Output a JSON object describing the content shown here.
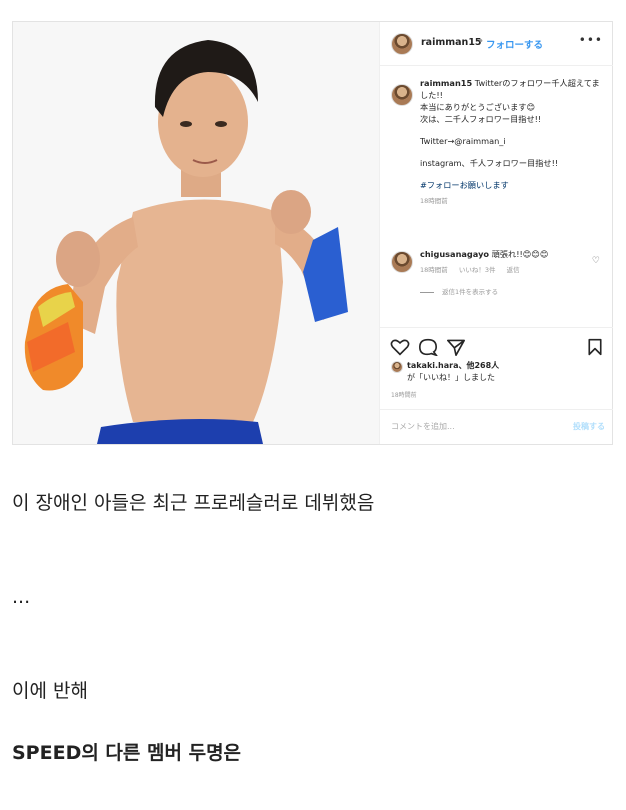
{
  "post": {
    "username": "raimman15",
    "follow_label": "フォローする",
    "caption_lines": [
      "Twitterのフォロワー千人超えてました!!",
      "本当にありがとうございます😊",
      "次は、二千人フォロワー目指せ!!"
    ],
    "twitter_line": "Twitter→@raimman_i",
    "instagram_line": "instagram、千人フォロワー目指せ!!",
    "hashtag": "#フォローお願いします",
    "time": "18時間前",
    "comment": {
      "user": "chigusanagayo",
      "text": "頑張れ!!😊😊😊",
      "time": "18時間前",
      "likes": "いいね！3件",
      "reply": "返信",
      "view_replies": "返信1件を表示する"
    },
    "liked_by": "takaki.hara、他268人",
    "liked_suffix": "が「いいね！」しました",
    "post_time": "18時間前",
    "comment_placeholder": "コメントを追加...",
    "post_button": "投稿する"
  },
  "article": {
    "line1": "이 장애인 아들은 최근 프로레슬러로 데뷔했음",
    "line2": "...",
    "line3": "이에 반해",
    "line4": "SPEED의 다른 멤버 두명은"
  }
}
